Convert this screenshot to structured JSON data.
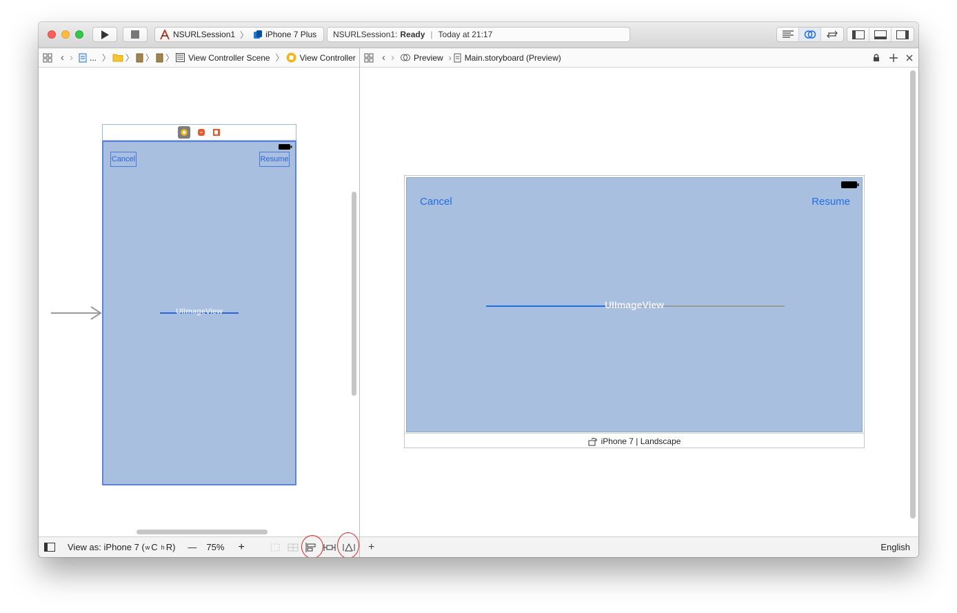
{
  "toolbar": {
    "scheme_target": "NSURLSession1",
    "scheme_device": "iPhone 7 Plus",
    "status_project": "NSURLSession1:",
    "status_state": "Ready",
    "status_time": "Today at 21:17"
  },
  "left_jumpbar": {
    "ellipsis": "...",
    "scene": "View Controller Scene",
    "controller": "View Controller"
  },
  "right_jumpbar": {
    "preview": "Preview",
    "file": "Main.storyboard (Preview)"
  },
  "storyboard": {
    "cancel_label": "Cancel",
    "resume_label": "Resume",
    "image_view_label": "UIImageView"
  },
  "preview": {
    "cancel_label": "Cancel",
    "resume_label": "Resume",
    "image_view_label": "UIImageView",
    "progress": 0.4,
    "device_label": "iPhone 7 | Landscape"
  },
  "bottom_left": {
    "view_as": "View as: iPhone 7 (",
    "size_w": "w",
    "size_c": "C",
    "size_h": "h",
    "size_r": "R)",
    "zoom_out": "—",
    "zoom_level": "75%",
    "zoom_in": "+"
  },
  "bottom_right": {
    "add": "+",
    "language": "English"
  },
  "colors": {
    "view_background": "#a9bfe0",
    "tint": "#1d6ee5",
    "progress_track": "#9a9a9a",
    "annotation": "#e02020"
  }
}
